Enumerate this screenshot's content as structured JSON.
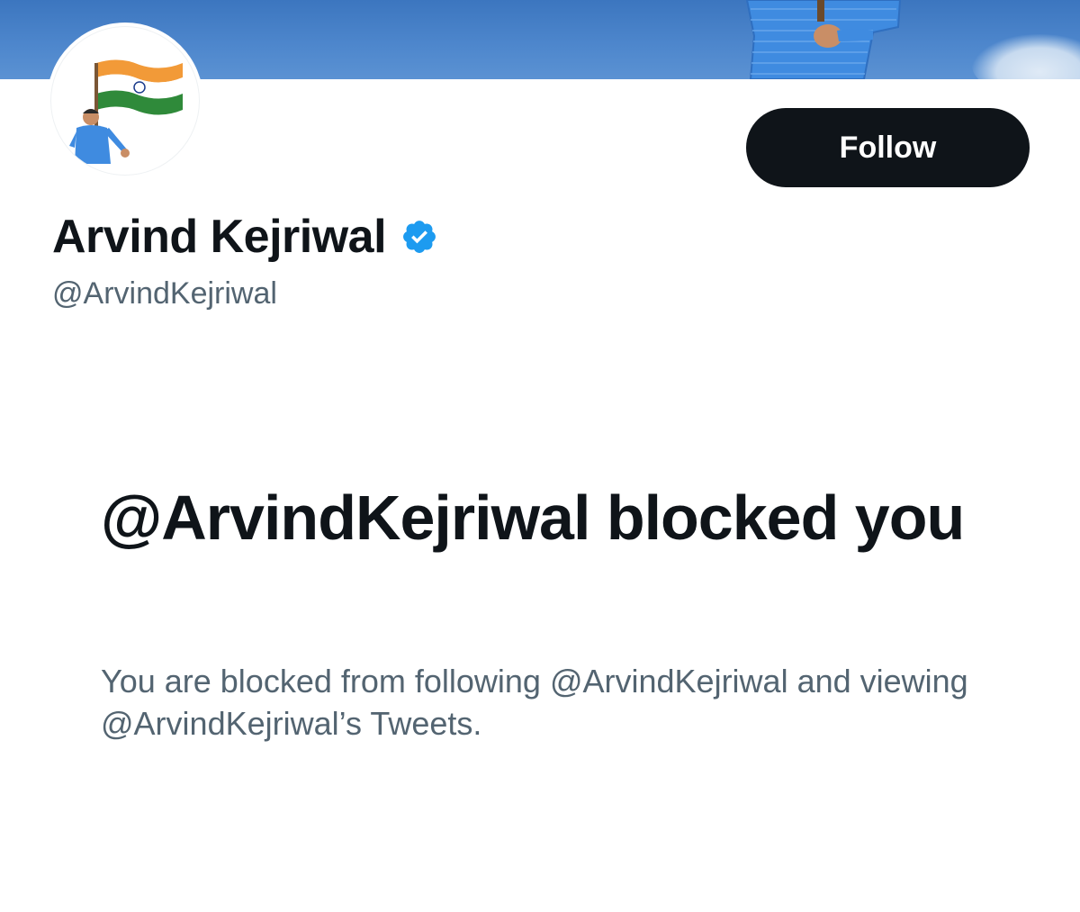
{
  "profile": {
    "display_name": "Arvind Kejriwal",
    "handle": "@ArvindKejriwal",
    "verified": true,
    "follow_label": "Follow",
    "banner_image": "person-holding-flag-against-blue-sky",
    "avatar_image": "person-waving-indian-flag"
  },
  "blocked": {
    "title": "@ArvindKejriwal blocked you",
    "description": "You are blocked from following @ArvindKejriwal and viewing @ArvindKejriwal’s Tweets."
  },
  "colors": {
    "text_primary": "#0f1419",
    "text_secondary": "#536471",
    "button_bg": "#0f1419",
    "verified_badge": "#1d9bf0",
    "banner_sky": "#4a83c9"
  },
  "icons": {
    "verified": "verified-badge-icon"
  }
}
